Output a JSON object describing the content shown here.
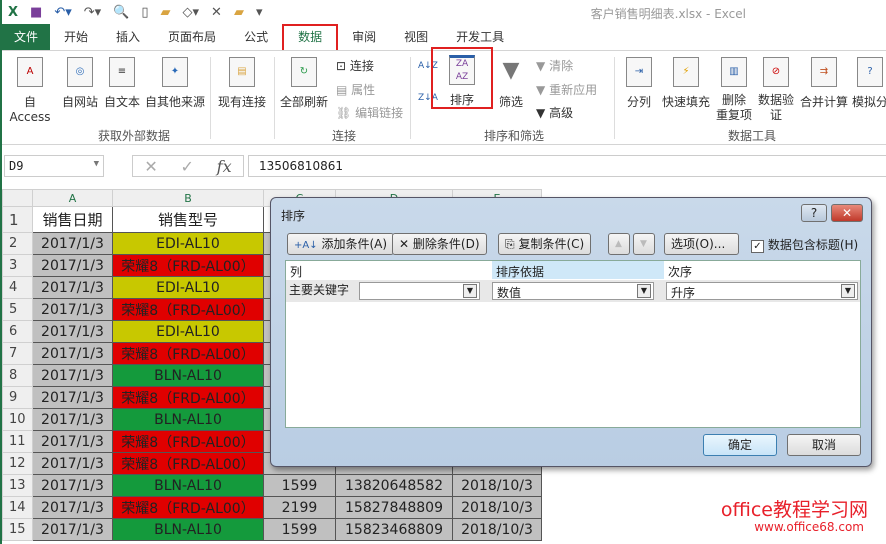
{
  "window": {
    "title": "客户销售明细表.xlsx - Excel"
  },
  "tabs": [
    "文件",
    "开始",
    "插入",
    "页面布局",
    "公式",
    "数据",
    "审阅",
    "视图",
    "开发工具"
  ],
  "ribbon": {
    "get_external": {
      "items": [
        "自 Access",
        "自网站",
        "自文本",
        "自其他来源",
        "现有连接"
      ],
      "label": "获取外部数据"
    },
    "connections": {
      "refresh_all": "全部刷新",
      "connect": "连接",
      "properties": "属性",
      "edit_links": "编辑链接",
      "label": "连接"
    },
    "sort_filter": {
      "sort": "排序",
      "filter": "筛选",
      "clear": "清除",
      "reapply": "重新应用",
      "advanced": "高级",
      "label": "排序和筛选"
    },
    "data_tools": {
      "items": [
        "分列",
        "快速填充",
        "删除\n重复项",
        "数据验\n证",
        "合并计算",
        "模拟分"
      ],
      "label": "数据工具"
    }
  },
  "formula_bar": {
    "name_box": "D9",
    "value": "13506810861"
  },
  "sheet": {
    "columns": [
      "A",
      "B",
      "C",
      "D",
      "E"
    ],
    "headers": [
      "销售日期",
      "销售型号"
    ],
    "rows": [
      {
        "n": "2",
        "date": "2017/1/3",
        "model": "EDI-AL10",
        "color": "#c8c800"
      },
      {
        "n": "3",
        "date": "2017/1/3",
        "model": "荣耀8（FRD-AL00）",
        "color": "#e00000"
      },
      {
        "n": "4",
        "date": "2017/1/3",
        "model": "EDI-AL10",
        "color": "#c8c800"
      },
      {
        "n": "5",
        "date": "2017/1/3",
        "model": "荣耀8（FRD-AL00）",
        "color": "#e00000"
      },
      {
        "n": "6",
        "date": "2017/1/3",
        "model": "EDI-AL10",
        "color": "#c8c800"
      },
      {
        "n": "7",
        "date": "2017/1/3",
        "model": "荣耀8（FRD-AL00）",
        "color": "#e00000"
      },
      {
        "n": "8",
        "date": "2017/1/3",
        "model": "BLN-AL10",
        "color": "#149a3c"
      },
      {
        "n": "9",
        "date": "2017/1/3",
        "model": "荣耀8（FRD-AL00）",
        "color": "#e00000"
      },
      {
        "n": "10",
        "date": "2017/1/3",
        "model": "BLN-AL10",
        "color": "#149a3c"
      },
      {
        "n": "11",
        "date": "2017/1/3",
        "model": "荣耀8（FRD-AL00）",
        "color": "#e00000"
      },
      {
        "n": "12",
        "date": "2017/1/3",
        "model": "荣耀8（FRD-AL00）",
        "color": "#e00000"
      },
      {
        "n": "13",
        "date": "2017/1/3",
        "model": "BLN-AL10",
        "color": "#149a3c",
        "c": "1599",
        "d": "13820648582",
        "e": "2018/10/3"
      },
      {
        "n": "14",
        "date": "2017/1/3",
        "model": "荣耀8（FRD-AL00）",
        "color": "#e00000",
        "c": "2199",
        "d": "15827848809",
        "e": "2018/10/3"
      },
      {
        "n": "15",
        "date": "2017/1/3",
        "model": "BLN-AL10",
        "color": "#149a3c",
        "c": "1599",
        "d": "15823468809",
        "e": "2018/10/3"
      }
    ]
  },
  "dialog": {
    "title": "排序",
    "help": "?",
    "close": "✕",
    "add": "添加条件(A)",
    "delete": "删除条件(D)",
    "copy": "复制条件(C)",
    "options": "选项(O)...",
    "has_headers": "数据包含标题(H)",
    "has_headers_checked": true,
    "col_header": "列",
    "sorton_header": "排序依据",
    "order_header": "次序",
    "row_label": "主要关键字",
    "column_value": "",
    "sorton_value": "数值",
    "order_value": "升序",
    "ok": "确定",
    "cancel": "取消"
  },
  "watermark": {
    "name": "office教程学习网",
    "url": "www.office68.com"
  }
}
